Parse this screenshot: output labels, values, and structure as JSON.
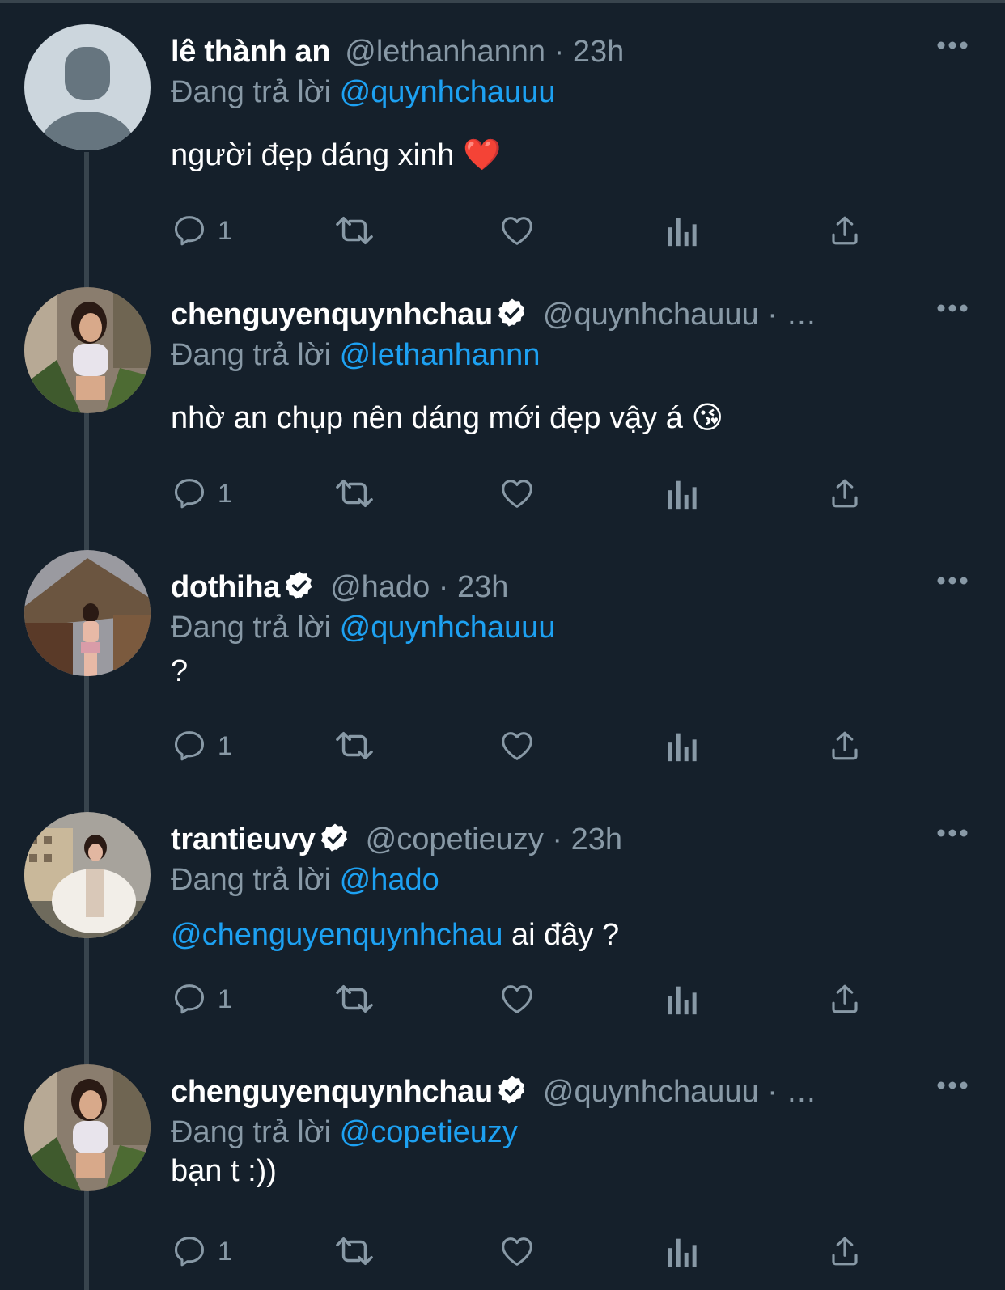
{
  "colors": {
    "background": "#15202b",
    "text": "#ffffff",
    "muted": "#8899a6",
    "accent": "#1da1f2",
    "verified": "#ffffff"
  },
  "icons": {
    "reply": "speech-bubble-icon",
    "retweet": "retweet-arrows-icon",
    "like": "heart-outline-icon",
    "analytics": "bar-chart-icon",
    "share": "upload-share-icon",
    "more": "ellipsis-icon",
    "verified": "verified-badge-icon"
  },
  "tweets": [
    {
      "name": "lê thành an",
      "verified": false,
      "handle": "@lethanhannn",
      "time_sep": " · 23h",
      "replying_prefix": "Đang trả lời ",
      "replying_to": "@quynhchauuu",
      "body_mention": "",
      "body": "người đẹp dáng xinh ❤️",
      "reply_count": "1"
    },
    {
      "name": "chenguyenquynhchau",
      "verified": true,
      "handle": "@quynhchauuu",
      "time_sep": " · …",
      "replying_prefix": "Đang trả lời ",
      "replying_to": "@lethanhannn",
      "body_mention": "",
      "body": "nhờ an chụp nên dáng mới đẹp vậy á 😘",
      "reply_count": "1"
    },
    {
      "name": "dothiha",
      "verified": true,
      "handle": "@hado",
      "time_sep": " · 23h",
      "replying_prefix": "Đang trả lời ",
      "replying_to": "@quynhchauuu",
      "body_mention": "",
      "body": "?",
      "reply_count": "1"
    },
    {
      "name": "trantieuvy",
      "verified": true,
      "handle": "@copetieuzy",
      "time_sep": " · 23h",
      "replying_prefix": "Đang trả lời ",
      "replying_to": "@hado",
      "body_mention": "@chenguyenquynhchau",
      "body": " ai đây ?",
      "reply_count": "1"
    },
    {
      "name": "chenguyenquynhchau",
      "verified": true,
      "handle": "@quynhchauuu",
      "time_sep": " · …",
      "replying_prefix": "Đang trả lời ",
      "replying_to": "@copetieuzy",
      "body_mention": "",
      "body": "bạn t :))",
      "reply_count": "1"
    }
  ]
}
